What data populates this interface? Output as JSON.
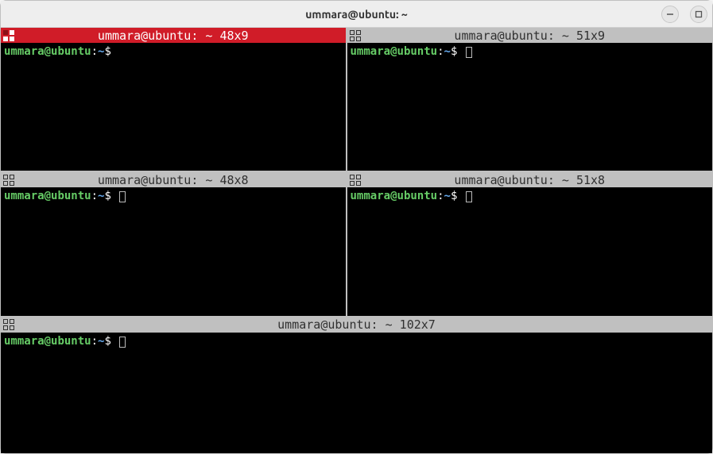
{
  "window": {
    "title": "ummara@ubuntu: ~"
  },
  "panes": [
    {
      "id": "top-left",
      "title": "ummara@ubuntu: ~ 48x9",
      "active": true,
      "prompt": {
        "user": "ummara",
        "host": "ubuntu",
        "path": "~",
        "symbol": "$"
      },
      "show_cursor": false
    },
    {
      "id": "top-right",
      "title": "ummara@ubuntu: ~ 51x9",
      "active": false,
      "prompt": {
        "user": "ummara",
        "host": "ubuntu",
        "path": "~",
        "symbol": "$"
      },
      "show_cursor": true
    },
    {
      "id": "mid-left",
      "title": "ummara@ubuntu: ~ 48x8",
      "active": false,
      "prompt": {
        "user": "ummara",
        "host": "ubuntu",
        "path": "~",
        "symbol": "$"
      },
      "show_cursor": true
    },
    {
      "id": "mid-right",
      "title": "ummara@ubuntu: ~ 51x8",
      "active": false,
      "prompt": {
        "user": "ummara",
        "host": "ubuntu",
        "path": "~",
        "symbol": "$"
      },
      "show_cursor": true
    },
    {
      "id": "bottom",
      "title": "ummara@ubuntu: ~ 102x7",
      "active": false,
      "prompt": {
        "user": "ummara",
        "host": "ubuntu",
        "path": "~",
        "symbol": "$"
      },
      "show_cursor": true
    }
  ],
  "colors": {
    "active_title_bg": "#d01c28",
    "inactive_title_bg": "#c0c0c0",
    "prompt_user": "#66cc66",
    "prompt_path": "#66aaee",
    "terminal_bg": "#000000"
  }
}
